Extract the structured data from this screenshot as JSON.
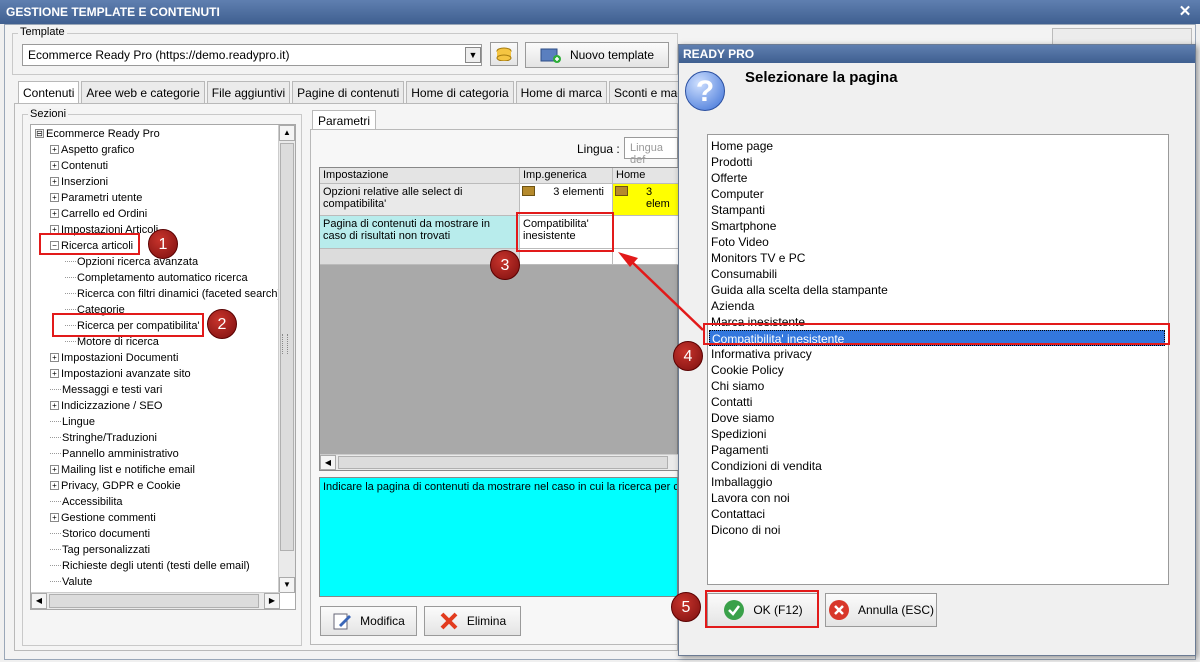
{
  "window": {
    "title": "GESTIONE TEMPLATE E CONTENUTI",
    "close_glyph": "✕"
  },
  "template": {
    "group_label": "Template",
    "selected": "Ecommerce Ready Pro (https://demo.readypro.it)",
    "new_button": "Nuovo template"
  },
  "tabs": [
    "Contenuti",
    "Aree web e categorie",
    "File aggiuntivi",
    "Pagine di contenuti",
    "Home di categoria",
    "Home di marca",
    "Sconti e maggiorazioni"
  ],
  "sections": {
    "label": "Sezioni",
    "tree": [
      {
        "text": "Ecommerce Ready Pro",
        "level": 0,
        "expander": "⊟"
      },
      {
        "text": "Aspetto grafico",
        "level": 1,
        "expander": "+"
      },
      {
        "text": "Contenuti",
        "level": 1,
        "expander": "+"
      },
      {
        "text": "Inserzioni",
        "level": 1,
        "expander": "+"
      },
      {
        "text": "Parametri utente",
        "level": 1,
        "expander": "+"
      },
      {
        "text": "Carrello ed Ordini",
        "level": 1,
        "expander": "+"
      },
      {
        "text": "Impostazioni Articoli",
        "level": 1,
        "expander": "+"
      },
      {
        "text": "Ricerca articoli",
        "level": 1,
        "expander": "−"
      },
      {
        "text": "Opzioni ricerca avanzata",
        "level": 2,
        "expander": ""
      },
      {
        "text": "Completamento automatico ricerca",
        "level": 2,
        "expander": ""
      },
      {
        "text": "Ricerca con filtri dinamici (faceted search)",
        "level": 2,
        "expander": ""
      },
      {
        "text": "Categorie",
        "level": 2,
        "expander": ""
      },
      {
        "text": "Ricerca per compatibilita'",
        "level": 2,
        "expander": ""
      },
      {
        "text": "Motore di ricerca",
        "level": 2,
        "expander": ""
      },
      {
        "text": "Impostazioni Documenti",
        "level": 1,
        "expander": "+"
      },
      {
        "text": "Impostazioni avanzate sito",
        "level": 1,
        "expander": "+"
      },
      {
        "text": "Messaggi e testi vari",
        "level": 1,
        "expander": ""
      },
      {
        "text": "Indicizzazione / SEO",
        "level": 1,
        "expander": "+"
      },
      {
        "text": "Lingue",
        "level": 1,
        "expander": ""
      },
      {
        "text": "Stringhe/Traduzioni",
        "level": 1,
        "expander": ""
      },
      {
        "text": "Pannello amministrativo",
        "level": 1,
        "expander": ""
      },
      {
        "text": "Mailing list e notifiche email",
        "level": 1,
        "expander": "+"
      },
      {
        "text": "Privacy, GDPR e Cookie",
        "level": 1,
        "expander": "+"
      },
      {
        "text": "Accessibilita",
        "level": 1,
        "expander": ""
      },
      {
        "text": "Gestione commenti",
        "level": 1,
        "expander": "+"
      },
      {
        "text": "Storico documenti",
        "level": 1,
        "expander": ""
      },
      {
        "text": "Tag personalizzati",
        "level": 1,
        "expander": ""
      },
      {
        "text": "Richieste degli utenti (testi delle email)",
        "level": 1,
        "expander": ""
      },
      {
        "text": "Valute",
        "level": 1,
        "expander": ""
      }
    ]
  },
  "params": {
    "tab": "Parametri",
    "lingua_label": "Lingua :",
    "lingua_placeholder": "Lingua def",
    "columns": [
      "Impostazione",
      "Imp.generica",
      "Home"
    ],
    "rows": [
      {
        "setting": "Opzioni relative alle select di compatibilita'",
        "generic": "3 elementi",
        "home": "3 elem"
      },
      {
        "setting": "Pagina di contenuti da mostrare in caso di risultati non trovati",
        "generic": "Compatibilita' inesistente",
        "home": ""
      }
    ],
    "description": "Indicare la pagina di contenuti da mostrare nel caso in cui la ricerca per co",
    "modify_button": "Modifica",
    "delete_button": "Elimina"
  },
  "dialog": {
    "title": "READY PRO",
    "heading": "Selezionare la pagina",
    "pages": [
      "Home page",
      "Prodotti",
      "Offerte",
      "Computer",
      "Stampanti",
      "Smartphone",
      "Foto Video",
      "Monitors TV e PC",
      "Consumabili",
      "Guida alla scelta della stampante",
      "Azienda",
      "Marca inesistente",
      "Compatibilita' inesistente",
      "Informativa privacy",
      "Cookie Policy",
      "Chi siamo",
      "Contatti",
      "Dove siamo",
      "Spedizioni",
      "Pagamenti",
      "Condizioni di vendita",
      "Imballaggio",
      "Lavora con noi",
      "Contattaci",
      "Dicono di noi"
    ],
    "selected": "Compatibilita' inesistente",
    "ok_button": "OK (F12)",
    "cancel_button": "Annulla (ESC)"
  },
  "callouts": [
    "1",
    "2",
    "3",
    "4",
    "5"
  ],
  "colors": {
    "highlight_cyan": "#00ffff",
    "row_cyan": "#b8ecec",
    "yellow": "#ffff00",
    "selection": "#3377dd",
    "annotation_red": "#e21a1a"
  }
}
